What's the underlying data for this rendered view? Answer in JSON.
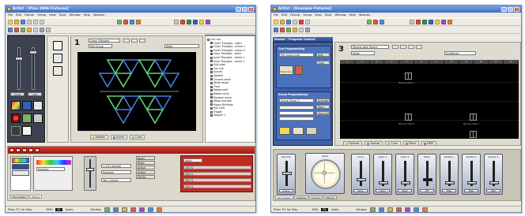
{
  "windows": [
    {
      "title": "Artist - [Pixa 2006 Fixtures]",
      "menu": [
        "File",
        "Edit",
        "Fixture",
        "Group",
        "View",
        "Tools",
        "Window",
        "Help",
        "Wizards"
      ],
      "master_header": "Master - Global Control",
      "master_levels": [
        "75.00",
        "100"
      ],
      "main_number": "1",
      "main_dropdowns": [
        "Large Triangles",
        "Red Group",
        "Node"
      ],
      "navigator_header": "Navigator - Cues",
      "navigator_items": [
        "Cue List",
        "Outer Triangles - static",
        "Outer Triangles - active 1",
        "Outer Triangles - active 2",
        "Inner Triangles - static",
        "Inner Triangles - active 1",
        "Inner Triangles - active 2",
        "Silly pixel",
        "Sun rise",
        "Sunset",
        "Sparkle",
        "Chroma wave",
        "White stripe",
        "Time",
        "Rotate split",
        "Rotate circle",
        "Random pulse",
        "Mega cascade",
        "Happy Birthday",
        "Run cells",
        "Trigger",
        "Stopper 1"
      ],
      "main_tabs": [
        "Palette",
        "Scene",
        "Cues"
      ],
      "effect_fields": [
        "Rainbow",
        "1-1 B (default)",
        "Rainbow",
        "Tab 1 Active"
      ],
      "effect_buttons": [
        "Apply",
        "Relay",
        "Active",
        "Action",
        "Delete"
      ],
      "effect_side_title": "Apply",
      "effect_percents": [
        "100 %",
        "100 %",
        "100 %",
        "100 %"
      ],
      "bottom_tabs": [
        "Parameters",
        "Effects"
      ],
      "status_text": "Press 'F1' for Help",
      "status_dmx_label": "DMX",
      "status_dmx_value": "80",
      "status_mode": "Audio",
      "status_window": "Window",
      "status_buttons": [
        "Pictures",
        "Cursor",
        "Navigator",
        "Master",
        "Palettes",
        "Automator",
        "Preview"
      ]
    },
    {
      "title": "Artist - [Example Fixtures]",
      "menu": [
        "File",
        "Edit",
        "Fixture",
        "Group",
        "View",
        "Tools",
        "Window",
        "Help",
        "Wizards"
      ],
      "master_header": "Master - Program Control",
      "cue_section_title": "Cue Programming",
      "cue_dropdown": "Pan move cues",
      "cue_buttons": [
        "Move Cue",
        "Dist.",
        "Clear"
      ],
      "scene_section_title": "Scene Programming",
      "scene_dropdown": "Scene Group 1",
      "scene_buttons": [
        "Activate",
        "Store",
        "Store Ext."
      ],
      "main_number": "3",
      "main_dropdowns": [
        "Moving Yoke Fixture",
        "Value",
        "Undefined"
      ],
      "stage_columns": [
        "1",
        "2",
        "3",
        "4",
        "5",
        "6",
        "7",
        "8",
        "9",
        "10",
        "11",
        "12"
      ],
      "fixture_labels": [
        "Moving Yoke 1",
        "Moving Yoke 2",
        "Moving Yoke 3",
        "Moving Yoke 4"
      ],
      "main_tabs": [
        "Fixtures",
        "Scenes",
        "Cues",
        "Patch",
        "DMX"
      ],
      "channels": [
        {
          "name": "Dimmer",
          "value": "Cosine"
        },
        {
          "name": "Color",
          "value": "Open"
        },
        {
          "name": "Gobo 1",
          "value": "Open"
        },
        {
          "name": "Gobo 2",
          "value": "Open"
        },
        {
          "name": "Prism",
          "value": "Off"
        },
        {
          "name": "Rotate 1",
          "value": "Stop"
        },
        {
          "name": "Rotate 2",
          "value": "Stop"
        },
        {
          "name": "Rotate 3",
          "value": "Stop"
        }
      ],
      "wheel_title": "Value",
      "bottom_tabs": [
        "Parameters",
        "Palettes",
        "Colours",
        "Effects"
      ],
      "status_text": "Press 'F1' for Help",
      "status_dmx_label": "DMX",
      "status_dmx_value": "80",
      "status_mode": "Audio",
      "status_window": "Window",
      "status_buttons": [
        "Pictures",
        "Cursor",
        "Navigator",
        "Master",
        "Palettes",
        "Automator",
        "Preview"
      ]
    }
  ],
  "colors": {
    "titlebar": "#3e6cc4",
    "panel_blue": "#3d5fa6",
    "effect_red": "#c22a20",
    "stage_bg": "#000000",
    "pixel_green": "#5fd07a",
    "pixel_blue": "#4a7bd8"
  },
  "icons": [
    "app-icon",
    "minimize-icon",
    "maximize-icon",
    "close-icon"
  ]
}
